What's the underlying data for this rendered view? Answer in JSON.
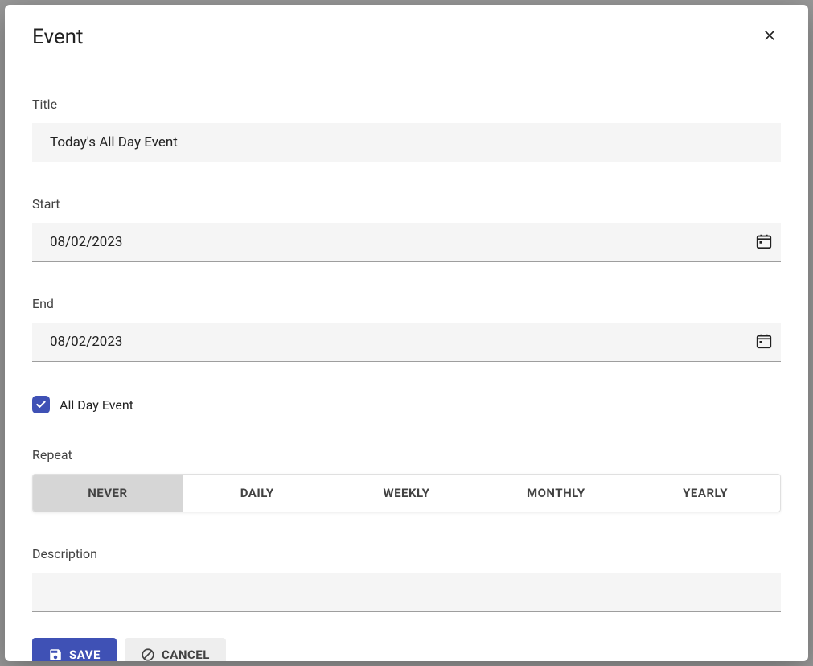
{
  "modal": {
    "title": "Event"
  },
  "fields": {
    "title": {
      "label": "Title",
      "value": "Today's All Day Event"
    },
    "start": {
      "label": "Start",
      "value": "08/02/2023"
    },
    "end": {
      "label": "End",
      "value": "08/02/2023"
    },
    "allDay": {
      "label": "All Day Event",
      "checked": true
    },
    "repeat": {
      "label": "Repeat",
      "options": [
        "NEVER",
        "DAILY",
        "WEEKLY",
        "MONTHLY",
        "YEARLY"
      ],
      "selected": "NEVER"
    },
    "description": {
      "label": "Description",
      "value": ""
    }
  },
  "buttons": {
    "save": "SAVE",
    "cancel": "CANCEL"
  }
}
